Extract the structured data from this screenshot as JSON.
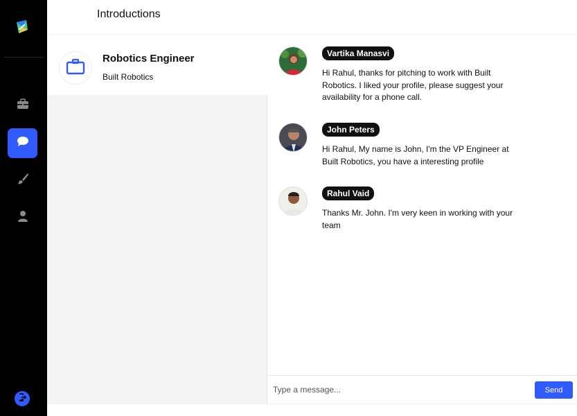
{
  "header": {
    "title": "Introductions"
  },
  "sidebar": {
    "logo_icon": "app-logo-icon",
    "items": [
      {
        "icon": "briefcase-icon",
        "active": false
      },
      {
        "icon": "chat-icon",
        "active": true
      },
      {
        "icon": "brush-icon",
        "active": false
      },
      {
        "icon": "user-icon",
        "active": false
      }
    ],
    "logout_icon": "logout-icon",
    "accent": "#2f5bff"
  },
  "conversation": {
    "title": "Robotics Engineer",
    "company": "Built Robotics",
    "icon": "briefcase-icon"
  },
  "messages": [
    {
      "name": "Vartika Manasvi",
      "text": "Hi Rahul, thanks for pitching to work with Built Robotics. I liked your profile, please suggest your availability for a phone call."
    },
    {
      "name": "John Peters",
      "text": "Hi Rahul, My name is John, I'm the VP Engineer at Built Robotics, you have a interesting profile"
    },
    {
      "name": "Rahul Vaid",
      "text": "Thanks Mr. John. I'm very keen in working with your team"
    }
  ],
  "composer": {
    "placeholder": "Type a message...",
    "send_label": "Send"
  }
}
